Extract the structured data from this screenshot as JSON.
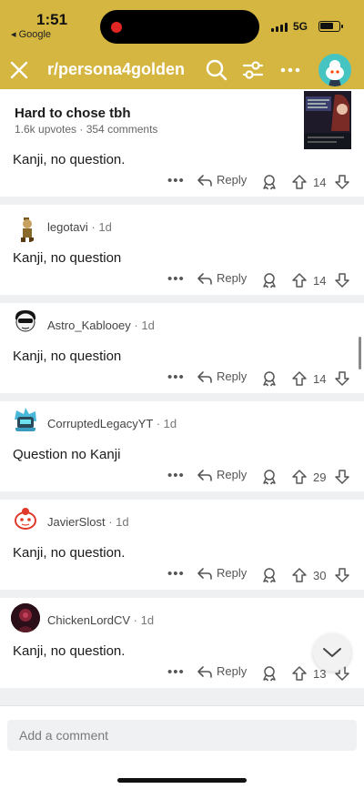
{
  "status": {
    "time": "1:51",
    "back_app": "◂ Google",
    "network": "5G"
  },
  "header": {
    "subreddit": "r/persona4golden"
  },
  "post": {
    "title": "Hard to chose tbh",
    "meta": "1.6k upvotes · 354 comments"
  },
  "first_comment": {
    "body": "Kanji, no question.",
    "score": "14"
  },
  "reply_label": "Reply",
  "comments": [
    {
      "username": "legotavi",
      "age": "· 1d",
      "body": "Kanji, no question",
      "score": "14"
    },
    {
      "username": "Astro_Kablooey",
      "age": "· 1d",
      "body": "Kanji, no question",
      "score": "14"
    },
    {
      "username": "CorruptedLegacyYT",
      "age": "· 1d",
      "body": "Question no Kanji",
      "score": "29"
    },
    {
      "username": "JavierSlost",
      "age": "· 1d",
      "body": "Kanji, no question.",
      "score": "30"
    },
    {
      "username": "ChickenLordCV",
      "age": "· 1d",
      "body": "Kanji, no question.",
      "score": "13"
    }
  ],
  "composer": {
    "placeholder": "Add a comment"
  },
  "colors": {
    "accent": "#d4b640",
    "avatar_teal": "#45c4c2",
    "separator": "#eef0f1"
  },
  "icons": [
    "close-icon",
    "search-icon",
    "sort-icon",
    "more-icon",
    "reply-icon",
    "award-icon",
    "upvote-icon",
    "downvote-icon",
    "chevron-down-icon"
  ]
}
